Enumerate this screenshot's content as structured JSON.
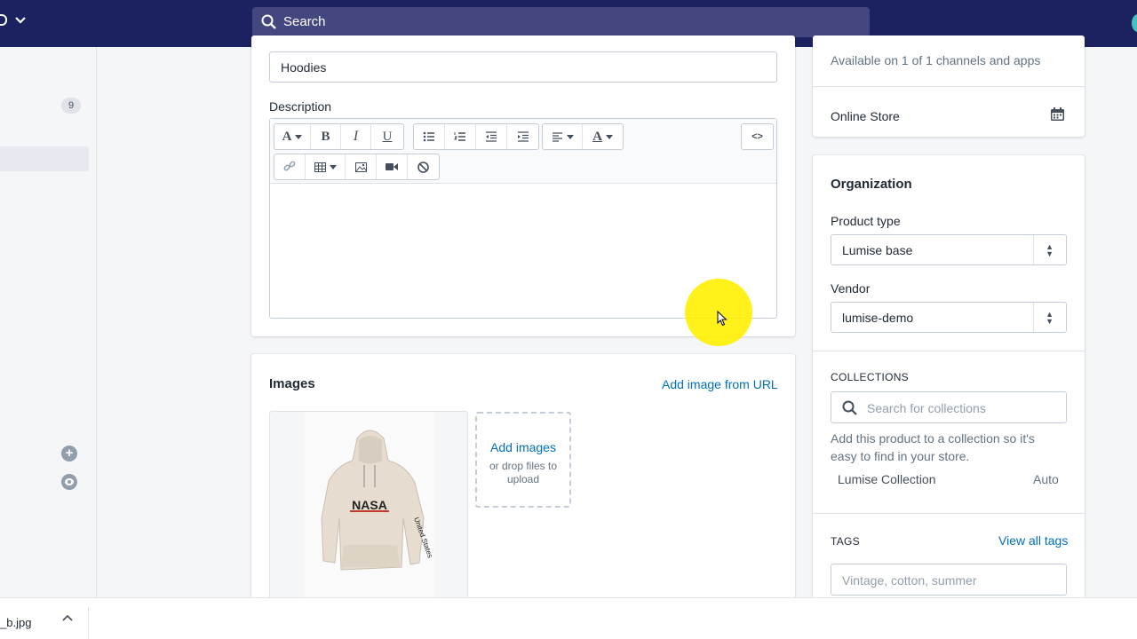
{
  "topbar": {
    "search_label": "Search"
  },
  "leftnav": {
    "badge_count": "9"
  },
  "product": {
    "title_value": "Hoodies",
    "description_label": "Description"
  },
  "editor_toolbar": {
    "font_glyph": "A",
    "bold_glyph": "B",
    "italic_glyph": "I",
    "underline_glyph": "U",
    "color_glyph": "A",
    "html_glyph": "<>"
  },
  "images": {
    "title": "Images",
    "add_from_url": "Add image from URL",
    "add_images": "Add images",
    "drop_hint": "or drop files to upload",
    "hoodie_print": "NASA",
    "sleeve_print": "United States"
  },
  "channels": {
    "availability": "Available on 1 of 1 channels and apps",
    "online_store": "Online Store"
  },
  "organization": {
    "title": "Organization",
    "product_type_label": "Product type",
    "product_type_value": "Lumise base",
    "vendor_label": "Vendor",
    "vendor_value": "lumise-demo",
    "collections_label": "COLLECTIONS",
    "collections_placeholder": "Search for collections",
    "collections_help": "Add this product to a collection so it's easy to find in your store.",
    "collection_name": "Lumise Collection",
    "collection_mode": "Auto",
    "tags_label": "TAGS",
    "view_all_tags": "View all tags",
    "tags_placeholder": "Vintage, cotton, summer"
  },
  "download_bar": {
    "file_name": "_b.jpg"
  },
  "colors": {
    "topbar": "#1c2260",
    "link": "#006fbb",
    "highlight": "#fff000"
  }
}
